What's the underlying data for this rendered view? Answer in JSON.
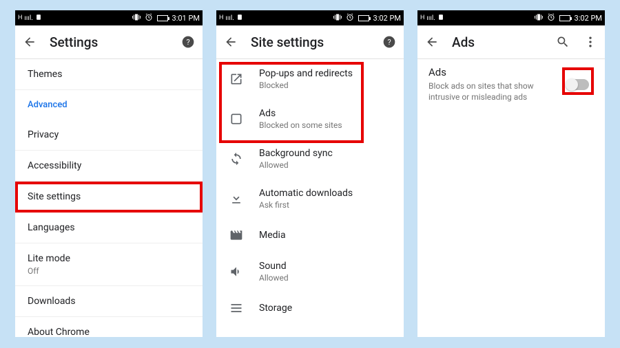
{
  "phones": [
    {
      "status_time": "3:01 PM",
      "title": "Settings",
      "items": {
        "themes": "Themes",
        "advanced": "Advanced",
        "privacy": "Privacy",
        "accessibility": "Accessibility",
        "site_settings": "Site settings",
        "languages": "Languages",
        "lite_mode": "Lite mode",
        "lite_mode_sub": "Off",
        "downloads": "Downloads",
        "about": "About Chrome"
      }
    },
    {
      "status_time": "3:02 PM",
      "title": "Site settings",
      "rows": {
        "popups": {
          "label": "Pop-ups and redirects",
          "sub": "Blocked"
        },
        "ads": {
          "label": "Ads",
          "sub": "Blocked on some sites"
        },
        "bgsync": {
          "label": "Background sync",
          "sub": "Allowed"
        },
        "autodl": {
          "label": "Automatic downloads",
          "sub": "Ask first"
        },
        "media": {
          "label": "Media",
          "sub": ""
        },
        "sound": {
          "label": "Sound",
          "sub": "Allowed"
        },
        "storage": {
          "label": "Storage",
          "sub": ""
        }
      }
    },
    {
      "status_time": "3:02 PM",
      "title": "Ads",
      "ads": {
        "label": "Ads",
        "sub": "Block ads on sites that show intrusive or misleading ads"
      }
    }
  ],
  "signal_label": "H"
}
